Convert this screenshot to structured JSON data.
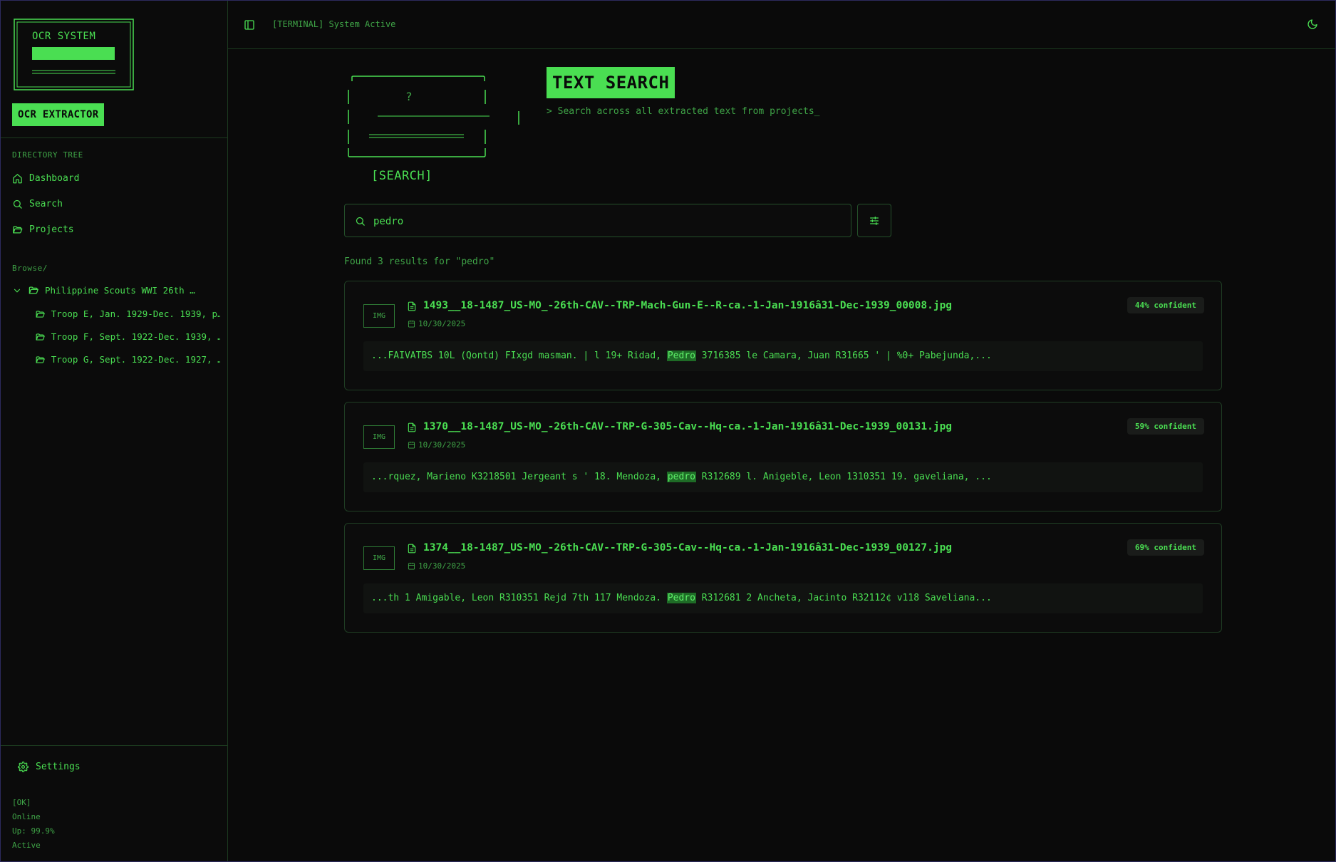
{
  "sidebar": {
    "logo_title": "OCR SYSTEM",
    "brand_label": "OCR EXTRACTOR",
    "section_label": "DIRECTORY TREE",
    "nav": [
      {
        "label": "Dashboard",
        "icon": "home-icon"
      },
      {
        "label": "Search",
        "icon": "search-icon"
      },
      {
        "label": "Projects",
        "icon": "folder-icon"
      }
    ],
    "browse_label": "Browse/",
    "tree": {
      "root": "Philippine Scouts WWI 26th …",
      "children": [
        "Troop E, Jan. 1929-Dec. 1939, p…",
        "Troop F, Sept. 1922-Dec. 1939, …",
        "Troop G, Sept. 1922-Dec. 1927, …"
      ]
    },
    "settings_label": "Settings",
    "status": [
      "[OK]",
      "Online",
      "Up: 99.9%",
      "Active"
    ]
  },
  "topbar": {
    "status_text": "[TERMINAL] System Active"
  },
  "hero": {
    "art_symbol": "?",
    "caption": "[SEARCH]",
    "title": "TEXT SEARCH",
    "subtitle": "> Search across all extracted text from projects_"
  },
  "search": {
    "query": "pedro",
    "results_text": "Found 3 results for \"pedro\""
  },
  "results": [
    {
      "badge": "IMG",
      "filename": "1493__18-1487_US-MO_-26th-CAV--TRP-Mach-Gun-E--R-ca.-1-Jan-1916â31-Dec-1939_00008.jpg",
      "date": "10/30/2025",
      "confidence": "44% confident",
      "snippet_before": "...FAIVATBS 10L (Qontd) FIxgd masman. | l 19+ Ridad, ",
      "snippet_match": "Pedro",
      "snippet_after": " 3716385 le Camara, Juan R31665 ' | %0+ Pabejunda,..."
    },
    {
      "badge": "IMG",
      "filename": "1370__18-1487_US-MO_-26th-CAV--TRP-G-305-Cav--Hq-ca.-1-Jan-1916â31-Dec-1939_00131.jpg",
      "date": "10/30/2025",
      "confidence": "59% confident",
      "snippet_before": "...rquez, Marieno K3218501 Jergeant s ' 18. Mendoza, ",
      "snippet_match": "pedro",
      "snippet_after": " R312689 l. Anigeble, Leon 1310351 19. gaveliana, ..."
    },
    {
      "badge": "IMG",
      "filename": "1374__18-1487_US-MO_-26th-CAV--TRP-G-305-Cav--Hq-ca.-1-Jan-1916â31-Dec-1939_00127.jpg",
      "date": "10/30/2025",
      "confidence": "69% confident",
      "snippet_before": "...th 1 Amigable, Leon R310351 Rejd 7th 117 Mendoza. ",
      "snippet_match": "Pedro",
      "snippet_after": " R312681 2 Ancheta, Jacinto R32112¢ v118 Saveliana..."
    }
  ],
  "colors": {
    "accent": "#4ade52",
    "background": "#0a0a0a",
    "highlight": "#1e6b26"
  }
}
